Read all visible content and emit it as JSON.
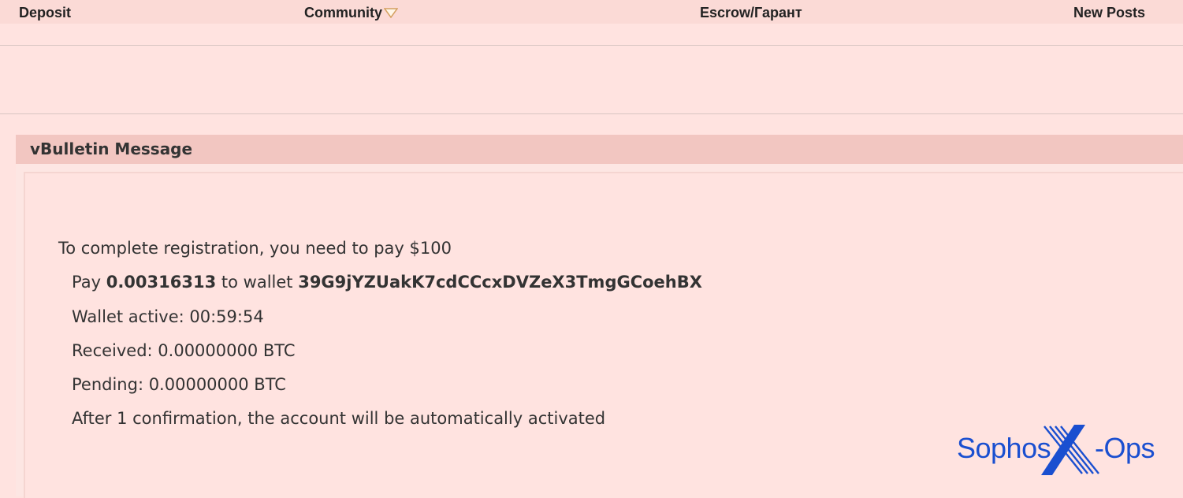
{
  "nav": {
    "items": [
      {
        "label": "Deposit"
      },
      {
        "label": "Community"
      },
      {
        "label": "Escrow/Гарант"
      },
      {
        "label": "New Posts"
      }
    ]
  },
  "message": {
    "title": "vBulletin Message",
    "intro": "To complete registration, you need to pay $100",
    "pay_prefix": "Pay",
    "amount": "0.00316313",
    "to_wallet": "to wallet",
    "wallet_address": "39G9jYZUakK7cdCCcxDVZeX3TmgGCoehBX",
    "wallet_active": "Wallet active: 00:59:54",
    "received": "Received: 0.00000000 BTC",
    "pending": "Pending: 0.00000000 BTC",
    "confirmation": "After 1 confirmation, the account will be automatically activated"
  },
  "logo": {
    "left": "Sophos",
    "mark": "X",
    "right": "-Ops",
    "color": "#1a4fd0"
  },
  "colors": {
    "page_background": "#ffe3e0",
    "navbar": "#fbdad6",
    "message_header": "#f2c6c1"
  }
}
